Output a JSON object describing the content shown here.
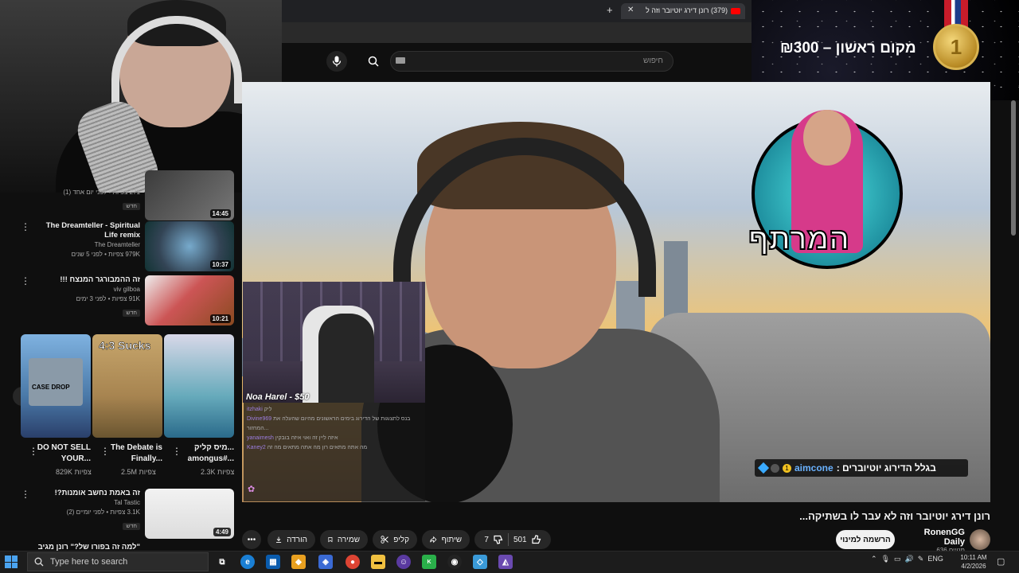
{
  "browser": {
    "tab_title": "(379) רונן דירג יוטיובר וזה ל",
    "new_tab_icon": "plus-icon",
    "close_icon": "close-icon"
  },
  "youtube_header": {
    "search_placeholder": "חיפוש"
  },
  "banner": {
    "text": "מקום ראשון – ₪300",
    "medal_number": "1"
  },
  "player": {
    "logo_text": "המרתף",
    "inset_label": "Noa Harel - $50",
    "chat": [
      {
        "user": "itzhaki",
        "msg": "ליק"
      },
      {
        "user": "Divine969",
        "msg": "בנס לתצוגות של הדירוג בימים הראשונים מהיום שהעלה את המחזור..."
      },
      {
        "user": "yanaimesh",
        "msg": "איזה ליין זה ואוי איזה בובקין"
      },
      {
        "user": "Kaney2",
        "msg": "מה אתה מתאים רון מה אתה מתאים מה זה"
      }
    ],
    "subtitle_user": "aimcone",
    "subtitle_text": ": בגלל הדירוג יוטיוברים"
  },
  "video": {
    "title": "רונן דירג יוטיובר וזה לא עבר לו בשתיקה...",
    "channel_name": "RonenGG Daily",
    "subscribers": "636 מנויים",
    "subscribe_label": "הרשמה למינוי",
    "likes": "501",
    "dislikes": "7",
    "share_label": "שיתוף",
    "clip_label": "קליפ",
    "save_label": "שמירה",
    "download_label": "הורדה"
  },
  "sidebar": {
    "items": [
      {
        "title": "",
        "channel": "",
        "views": "271 צפיות • לפני יום אחד (1)",
        "badge": "חדש",
        "duration": "14:45"
      },
      {
        "title": "The Dreamteller - Spiritual Life remix",
        "channel": "The Dreamteller",
        "views": "979K צפיות • לפני 5 שנים",
        "badge": "",
        "duration": "10:37"
      },
      {
        "title": "זה ההמבורגר המנצח !!!",
        "channel": "viv gilboa",
        "views": "91K צפיות • לפני 3 ימים",
        "badge": "חדש",
        "duration": "10:21"
      },
      {
        "title": "זה באמת נחשב אומנות?!",
        "channel": "Tal Tastic",
        "views": "3.1K צפיות • לפני יומיים (2)",
        "badge": "חדש",
        "duration": "4:49"
      },
      {
        "title": "\"למה זה בפורו של?\" רונן מגיב",
        "channel": "",
        "views": "",
        "badge": "",
        "duration": ""
      }
    ],
    "shorts": [
      {
        "title": "DO NOT SELL YOUR...",
        "views": "829K צפיות",
        "overlay": ""
      },
      {
        "title": "The Debate is Finally...",
        "views": "2.5M צפיות",
        "overlay": "4:3 Sucks"
      },
      {
        "title": "מיס קליק... amongus#...",
        "views": "2.3K צפיות",
        "overlay": ""
      }
    ],
    "short_case_label": "CASE DROP"
  },
  "taskbar": {
    "search_placeholder": "Type here to search",
    "lang": "ENG",
    "time": "10:11 AM",
    "date": "4/2/2026"
  },
  "colors": {
    "accent_red": "#ff0000",
    "subtitle_name": "#6ab2ff",
    "background": "#0f0f0f"
  }
}
